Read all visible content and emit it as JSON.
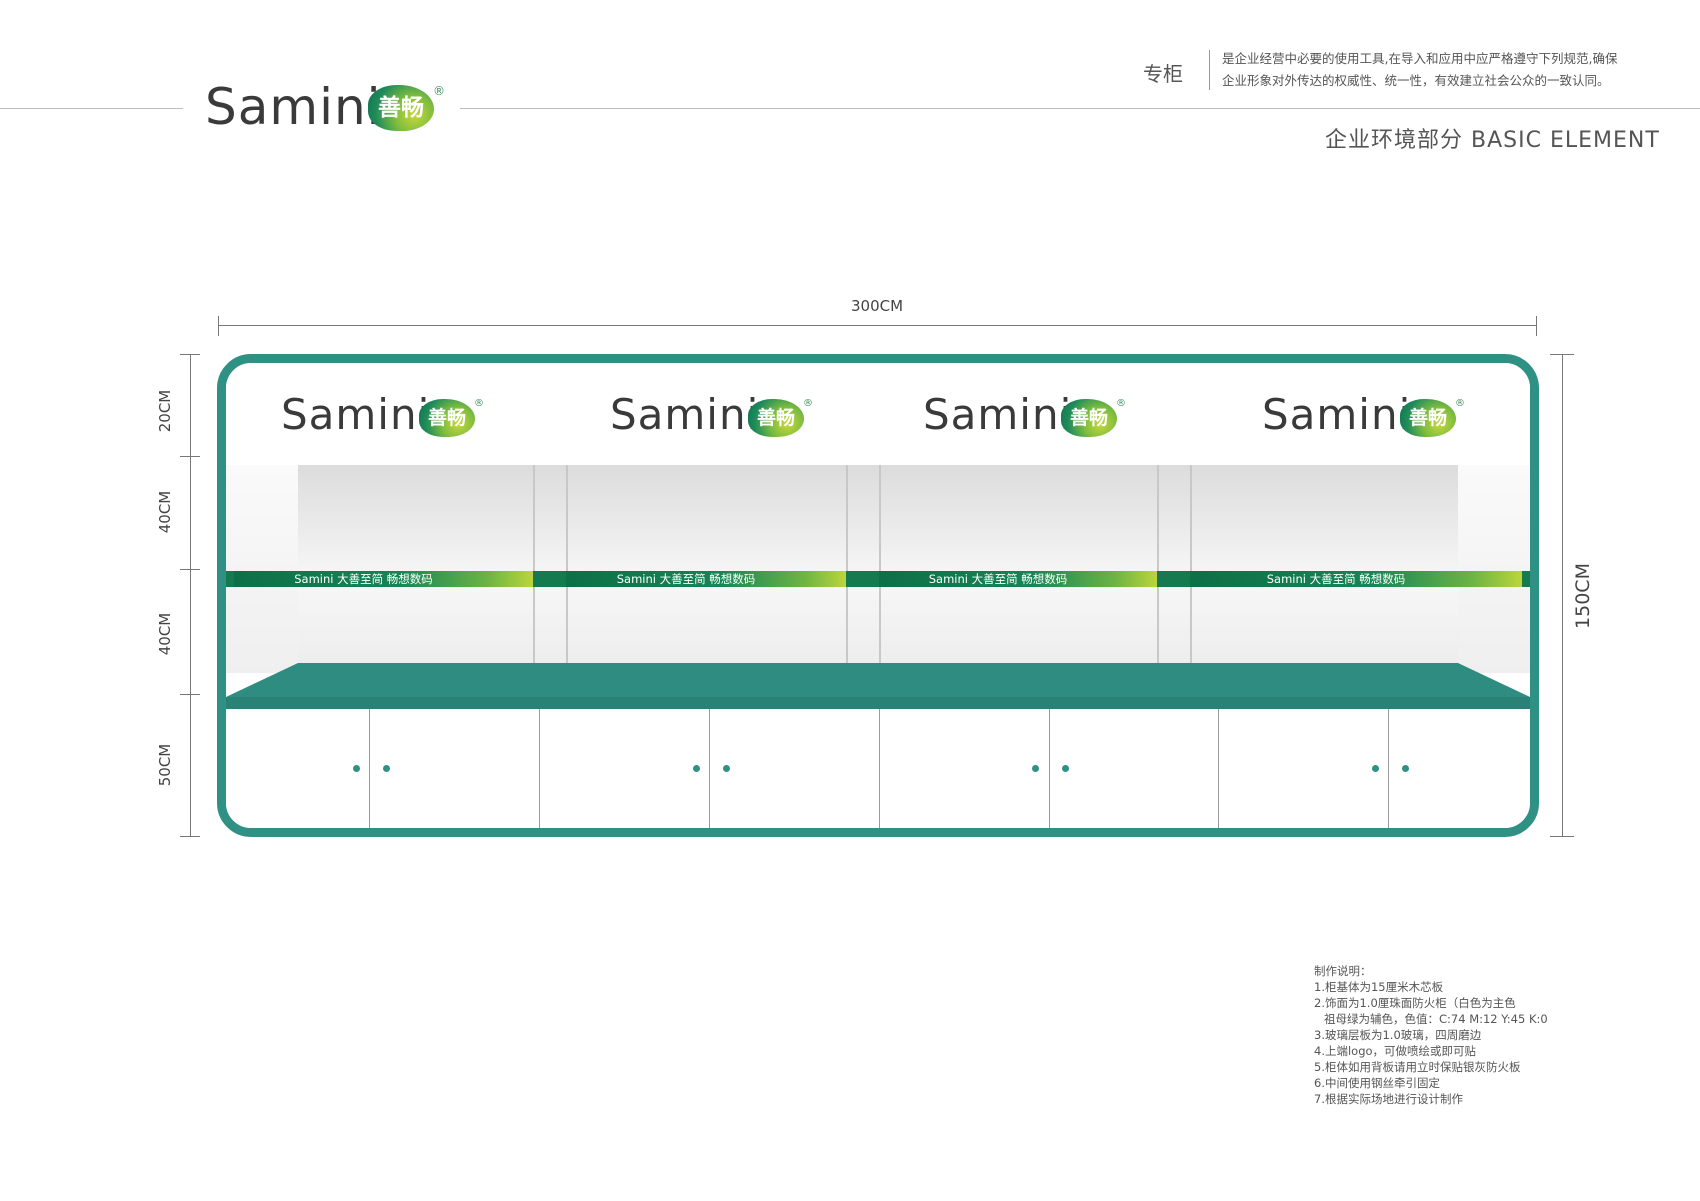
{
  "header": {
    "logo_word": "Samini",
    "logo_badge": "善畅",
    "logo_reg": "®",
    "section": "专柜",
    "description": [
      "是企业经营中必要的使用工具,在导入和应用中应严格遵守下列规范,确保",
      "企业形象对外传达的权威性、统一性，有效建立社会公众的一致认同。"
    ],
    "basic_element": "企业环境部分 BASIC ELEMENT"
  },
  "dimensions": {
    "width": "300CM",
    "height": "150CM",
    "segments": [
      "20CM",
      "40CM",
      "40CM",
      "50CM"
    ]
  },
  "cabinet": {
    "header_logo_word": "Samini",
    "header_logo_badge": "善畅",
    "header_logo_reg": "®",
    "banner_text": "Samini  大善至简 畅想数码",
    "colors": {
      "brand_green": "#2f9184",
      "banner_green": "#157a4f",
      "accent_yellow_green": "#bcd53a"
    }
  },
  "notes": {
    "title": "制作说明：",
    "items": [
      "1.柜基体为15厘米木芯板",
      "2.饰面为1.0厘珠面防火柜（白色为主色",
      "  祖母绿为辅色，色值：C:74  M:12 Y:45  K:0",
      "3.玻璃层板为1.0玻璃，四周磨边",
      "4.上端logo，可做喷绘或即可贴",
      "5.柜体如用背板请用立时保贴银灰防火板",
      "6.中间使用钢丝牵引固定",
      "7.根据实际场地进行设计制作"
    ]
  }
}
